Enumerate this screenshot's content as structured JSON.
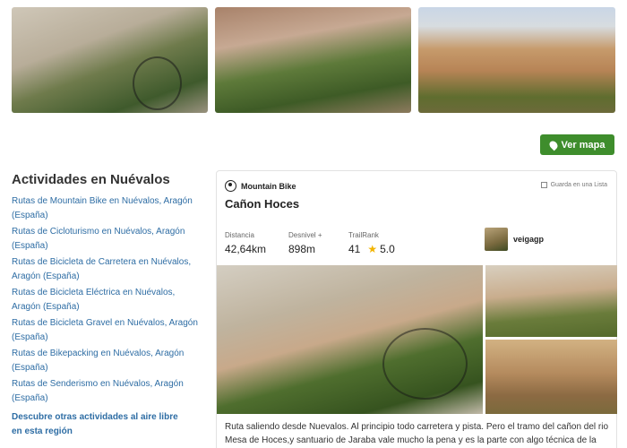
{
  "gallery_top": [
    {
      "alt": "mountain bike on cliff trail"
    },
    {
      "alt": "cyclist among shrubs in canyon"
    },
    {
      "alt": "canyon landscape with cliffs"
    }
  ],
  "map_button": {
    "label": "Ver mapa",
    "icon": "map-pin-icon"
  },
  "sidebar": {
    "title": "Actividades en Nuévalos",
    "items": [
      {
        "label": "Rutas de Mountain Bike en Nuévalos, Aragón (España)"
      },
      {
        "label": "Rutas de Cicloturismo en Nuévalos, Aragón (España)"
      },
      {
        "label": "Rutas de Bicicleta de Carretera en Nuévalos, Aragón (España)"
      },
      {
        "label": "Rutas de Bicicleta Eléctrica en Nuévalos, Aragón (España)"
      },
      {
        "label": "Rutas de Bicicleta Gravel en Nuévalos, Aragón (España)"
      },
      {
        "label": "Rutas de Bikepacking en Nuévalos, Aragón (España)"
      },
      {
        "label": "Rutas de Senderismo en Nuévalos, Aragón (España)"
      }
    ],
    "more_label": "Descubre otras actividades al aire libre en esta región"
  },
  "card": {
    "activity": "Mountain Bike",
    "activity_icon": "bike-icon",
    "save_label": "Guarda en una Lista",
    "title": "Cañon Hoces",
    "stats": {
      "distance_label": "Distancia",
      "distance_value": "42,64km",
      "elevation_label": "Desnivel +",
      "elevation_value": "898m",
      "trailrank_label": "TrailRank",
      "trailrank_value": "41",
      "rating_value": "5.0"
    },
    "author": "veigagp",
    "description": "Ruta saliendo desde Nuevalos. Al principio todo carretera y pista. Pero el tramo del cañon del rio Mesa de Hoces,y santuario de Jaraba vale mucho la pena y es la parte con algo técnica de la ruta. De vuelt..."
  },
  "colors": {
    "accent": "#3e8d2c",
    "link": "#2e6da4",
    "star": "#f2b400"
  }
}
